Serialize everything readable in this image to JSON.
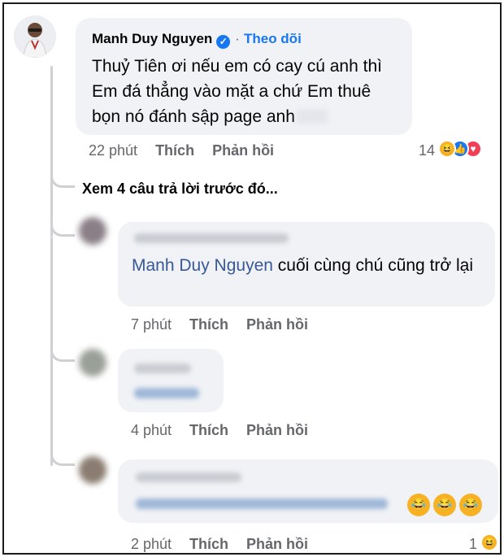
{
  "comment": {
    "author": "Manh Duy Nguyen",
    "verified_icon": "verified-badge-icon",
    "separator": "·",
    "follow_label": "Theo dõi",
    "text": "Thuỷ Tiên ơi nếu em có cay cú anh thì Em đá thẳng vào mặt a chứ Em thuê bọn nó đánh sập page anh",
    "time": "22 phút",
    "like_label": "Thích",
    "reply_label": "Phản hồi",
    "reaction_count": "14",
    "reactions": [
      "haha-reaction-icon",
      "like-reaction-icon",
      "love-reaction-icon"
    ]
  },
  "more_replies_label": "Xem 4 câu trả lời trước đó...",
  "replies": [
    {
      "mention": "Manh Duy Nguyen",
      "text": " cuối cùng chú cũng trở lại",
      "time": "7 phút",
      "like_label": "Thích",
      "reply_label": "Phản hồi"
    },
    {
      "time": "4 phút",
      "like_label": "Thích",
      "reply_label": "Phản hồi"
    },
    {
      "time": "2 phút",
      "like_label": "Thích",
      "reply_label": "Phản hồi",
      "emojis": [
        "😂",
        "😂",
        "😂"
      ],
      "reaction_count": "1",
      "reaction_icon": "haha-reaction-icon"
    }
  ],
  "colors": {
    "link_blue": "#1877f2",
    "bubble": "#f0f2f5",
    "meta_gray": "#65676b"
  }
}
